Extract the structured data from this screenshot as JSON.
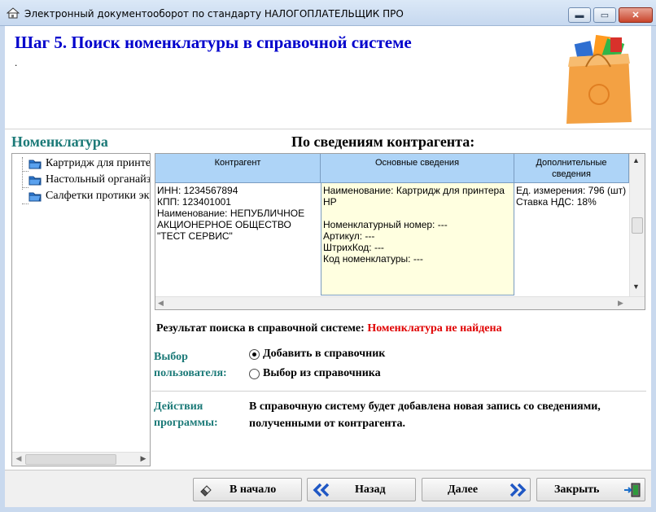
{
  "window": {
    "title": "Электронный документооборот по стандарту НАЛОГОПЛАТЕЛЬЩИК ПРО",
    "controls": {
      "minimize": "▬",
      "maximize": "▭",
      "close": "✕"
    }
  },
  "header": {
    "title": "Шаг 5. Поиск номенклатуры в справочной системе",
    "subtitle": "."
  },
  "nomenclature": {
    "title": "Номенклатура",
    "items": [
      {
        "label": "Картридж для принтера HP"
      },
      {
        "label": "Настольный органайзер"
      },
      {
        "label": "Салфетки протики экрана"
      }
    ]
  },
  "contractor": {
    "title": "По сведениям контрагента:",
    "columns": [
      "Контрагент",
      "Основные сведения",
      "Дополнительные\nсведения"
    ],
    "row": {
      "contractor": "ИНН: 1234567894\nКПП: 123401001\nНаименование: НЕПУБЛИЧНОЕ АКЦИОНЕРНОЕ ОБЩЕСТВО \"ТЕСТ СЕРВИС\"",
      "main": "Наименование: Картридж для принтера HP\n\nНоменклатурный номер: ---\nАртикул: ---\nШтрихКод: ---\nКод номенклатуры: ---",
      "extra": "Ед. измерения: 796 (шт)\nСтавка НДС: 18%"
    }
  },
  "search_result": {
    "label": "Результат поиска в справочной системе: ",
    "value": "Номенклатура не найдена"
  },
  "user_choice": {
    "label": "Выбор\nпользователя:",
    "options": [
      {
        "label": "Добавить в справочник",
        "selected": true
      },
      {
        "label": "Выбор из справочника",
        "selected": false
      }
    ]
  },
  "program_actions": {
    "label": "Действия\nпрограммы:",
    "text": "В справочную систему будет добавлена новая запись со сведениями, полученными от контрагента."
  },
  "buttons": {
    "home": "В начало",
    "back": "Назад",
    "next": "Далее",
    "close": "Закрыть"
  },
  "colors": {
    "header_title": "#0000cc",
    "teal_label": "#1c7a78",
    "result_error": "#e00000",
    "grid_header": "#aed4f7",
    "grid_highlight": "#ffffe0"
  }
}
